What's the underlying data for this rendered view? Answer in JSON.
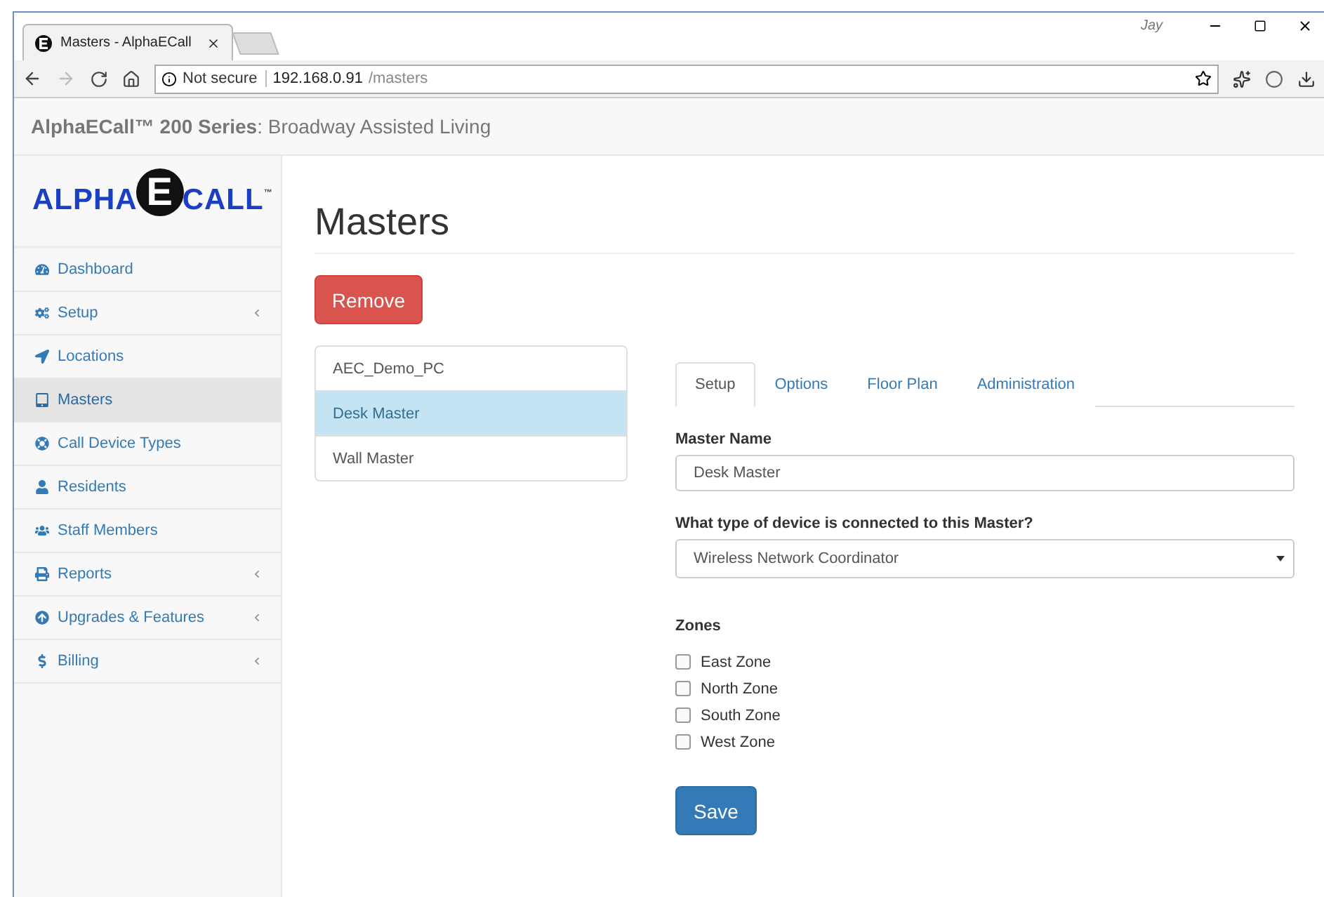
{
  "browser": {
    "tab_title": "Masters - AlphaECall",
    "profile": "Jay",
    "security": "Not secure",
    "url_host": "192.168.0.91",
    "url_path": "/masters",
    "forward_disabled": true
  },
  "header": {
    "brand": "AlphaECall™ 200 Series",
    "site": ": Broadway Assisted Living"
  },
  "logo": {
    "left": "ALPHA",
    "mark": "E",
    "right": "CALL",
    "tm": "™"
  },
  "sidebar": {
    "items": [
      {
        "label": "Dashboard",
        "selected": false,
        "expandable": false
      },
      {
        "label": "Setup",
        "selected": false,
        "expandable": true
      },
      {
        "label": "Locations",
        "selected": false,
        "expandable": false
      },
      {
        "label": "Masters",
        "selected": true,
        "expandable": false
      },
      {
        "label": "Call Device Types",
        "selected": false,
        "expandable": false
      },
      {
        "label": "Residents",
        "selected": false,
        "expandable": false
      },
      {
        "label": "Staff Members",
        "selected": false,
        "expandable": false
      },
      {
        "label": "Reports",
        "selected": false,
        "expandable": true
      },
      {
        "label": "Upgrades & Features",
        "selected": false,
        "expandable": true
      },
      {
        "label": "Billing",
        "selected": false,
        "expandable": true
      }
    ]
  },
  "page_title": "Masters",
  "remove_button": "Remove",
  "masters": [
    {
      "label": "AEC_Demo_PC",
      "selected": false
    },
    {
      "label": "Desk Master",
      "selected": true
    },
    {
      "label": "Wall Master",
      "selected": false
    }
  ],
  "tabs": [
    {
      "label": "Setup",
      "selected": true
    },
    {
      "label": "Options",
      "selected": false
    },
    {
      "label": "Floor Plan",
      "selected": false
    },
    {
      "label": "Administration",
      "selected": false
    }
  ],
  "form": {
    "name_label": "Master Name",
    "name_value": "Desk Master",
    "device_label": "What type of device is connected to this Master?",
    "device_value": "Wireless Network Coordinator",
    "zones_label": "Zones",
    "zones": [
      {
        "label": "East Zone",
        "checked": false
      },
      {
        "label": "North Zone",
        "checked": false
      },
      {
        "label": "South Zone",
        "checked": false
      },
      {
        "label": "West Zone",
        "checked": false
      }
    ],
    "save_button": "Save"
  }
}
